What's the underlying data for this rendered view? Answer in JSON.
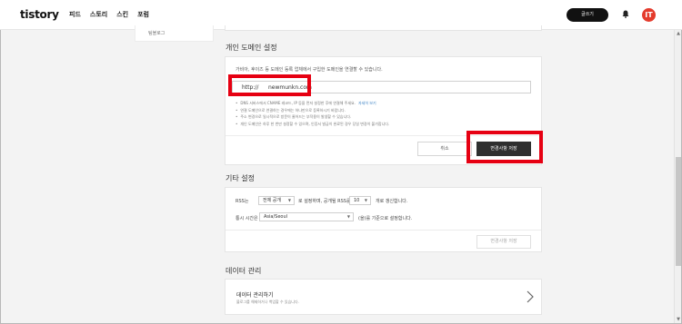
{
  "header": {
    "logo": "tistory",
    "nav": [
      "피드",
      "스토리",
      "스킨",
      "포럼"
    ],
    "write_button": "글쓰기",
    "avatar_initial": "IT",
    "avatar_color": "#e43b2c"
  },
  "sidebar": {
    "item": "팀블로그"
  },
  "domain_section": {
    "title": "개인 도메인 설정",
    "description": "가비아, 후이즈 등 도메인 등록 업체에서 구입한 도메인을 연결할 수 있습니다.",
    "prefix": "http://",
    "value": "newmunkn.com",
    "notes": [
      "DNS 서버스에서 CNAME 레코드, IP 등을 먼저 설정한 후에 연결해 주세요.",
      "연결 도메인으로 연결하는 경우에는 하나만으로 등록하시기 바랍니다.",
      "주소 변경으로 일시적으로 방문이 줄어드는 부작용이 발생할 수 있습니다.",
      "개인 도메인은 하루 한 번만 설정할 수 있으며, 인증서 발급이 완료된 경우 당일 변경이 불가합니다."
    ],
    "note_link": "자세히 보기",
    "cancel_button": "취소",
    "save_button": "변경사항 저장",
    "highlight_color": "#e60012"
  },
  "etc_section": {
    "title": "기타 설정",
    "rss_label": "RSS는",
    "rss_select": "전체 공개",
    "rss_mid": "로 설정하며, 공개될 RSS를",
    "rss_count": "10",
    "rss_suffix": "개로 갱신합니다.",
    "tz_label": "통시 시간은",
    "tz_select": "Asia/Seoul",
    "tz_suffix": "(을)를 기준으로 설정합니다.",
    "save_button": "변경사항 저장"
  },
  "data_section": {
    "title": "데이터 관리",
    "item_title": "데이터 관리하기",
    "item_sub": "블로그를 해제하거나 백업할 수 있습니다."
  }
}
